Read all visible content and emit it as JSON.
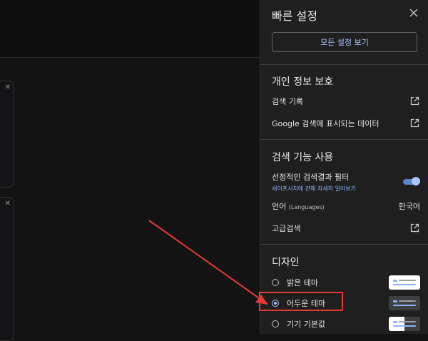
{
  "panel": {
    "title": "빠른 설정",
    "all_settings_label": "모든 설정 보기"
  },
  "privacy": {
    "title": "개인 정보 보호",
    "search_history": "검색 기록",
    "data_in_search": "Google 검색에 표시되는 데이터"
  },
  "search_features": {
    "title": "검색 기능 사용",
    "filter_label": "선정적인 검색결과 필터",
    "filter_link": "세이프서치에 관해 자세히 알아보기",
    "filter_on": true,
    "language_label": "언어",
    "language_hint": "(Languages)",
    "language_value": "한국어",
    "advanced_search": "고급검색"
  },
  "design": {
    "title": "디자인",
    "themes": [
      {
        "label": "밝은 테마",
        "selected": false
      },
      {
        "label": "어두운 테마",
        "selected": true
      },
      {
        "label": "기기 기본값",
        "selected": false
      }
    ]
  },
  "colors": {
    "accent": "#a8c7fa",
    "annotation": "#e53935"
  }
}
